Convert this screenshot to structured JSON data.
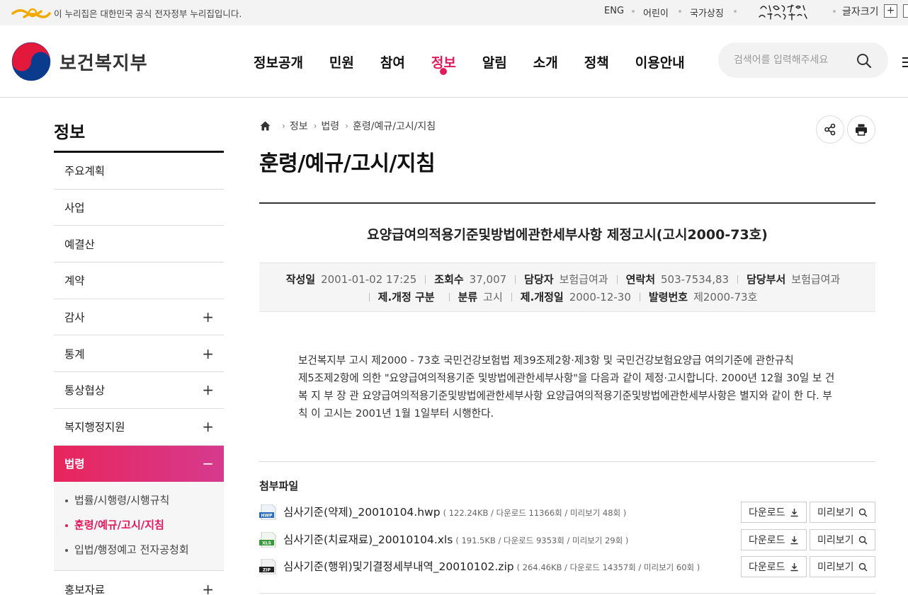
{
  "govbar": {
    "text": "이 누리집은 대한민국 공식 전자정부 누리집입니다.",
    "eng": "ENG",
    "kids": "어린이",
    "symbols": "국가상징",
    "font_size": "글자크기",
    "font_plus": "+",
    "font_minus": "-"
  },
  "header": {
    "brand": "보건복지부",
    "nav": [
      "정보공개",
      "민원",
      "참여",
      "정보",
      "알림",
      "소개",
      "정책",
      "이용안내"
    ],
    "search_placeholder": "검색어를 입력해주세요"
  },
  "lnb": {
    "title": "정보",
    "items": [
      {
        "label": "주요계획",
        "toggle": ""
      },
      {
        "label": "사업",
        "toggle": ""
      },
      {
        "label": "예결산",
        "toggle": ""
      },
      {
        "label": "계약",
        "toggle": ""
      },
      {
        "label": "감사",
        "toggle": "+"
      },
      {
        "label": "통계",
        "toggle": "+"
      },
      {
        "label": "통상협상",
        "toggle": "+"
      },
      {
        "label": "복지행정지원",
        "toggle": "+"
      },
      {
        "label": "법령",
        "toggle": "−"
      }
    ],
    "sub_items": [
      "법률/시행령/시행규칙",
      "훈령/예규/고시/지침",
      "입법/행정예고 전자공청회"
    ],
    "last_item": {
      "label": "홍보자료",
      "toggle": "+"
    }
  },
  "breadcrumb": [
    "정보",
    "법령",
    "훈령/예규/고시/지침"
  ],
  "page_title": "훈령/예규/고시/지침",
  "post": {
    "title": "요양급여의적용기준및방법에관한세부사항 제정고시(고시2000-73호)",
    "meta_row1": [
      {
        "k": "작성일",
        "v": "2001-01-02 17:25"
      },
      {
        "k": "조회수",
        "v": "37,007"
      },
      {
        "k": "담당자",
        "v": "보험급여과"
      },
      {
        "k": "연락처",
        "v": "503-7534,83"
      },
      {
        "k": "담당부서",
        "v": "보험급여과"
      }
    ],
    "meta_row2": [
      {
        "k": "제.개정 구분",
        "v": ""
      },
      {
        "k": "분류",
        "v": "고시"
      },
      {
        "k": "제.개정일",
        "v": "2000-12-30"
      },
      {
        "k": "발령번호",
        "v": "제2000-73호"
      }
    ],
    "body": [
      "보건복지부 고시 제2000 - 73호 국민건강보험법 제39조제2항·제3항 및 국민건강보험요양급 여의기준에 관한규칙",
      "제5조제2항에 의한 \"요양급여의적용기준 및방법에관한세부사항\"을 다음과 같이 제정·고시합니다. 2000년 12월 30일 보 건",
      "복 지 부 장 관 요양급여의적용기준및방법에관한세부사항 요양급여의적용기준및방법에관한세부사항은 별지와 같이 한 다. 부",
      "칙 이 고시는 2001년 1월 1일부터 시행한다."
    ]
  },
  "attachments": {
    "title": "첨부파일",
    "download_label": "다운로드",
    "preview_label": "미리보기",
    "files": [
      {
        "type": "HWP",
        "name": "심사기준(약제)_20010104.hwp",
        "info": "( 122.24KB / 다운로드 11366회 / 미리보기 48회 )"
      },
      {
        "type": "XLS",
        "name": "심사기준(치료재료)_20010104.xls",
        "info": "( 191.5KB / 다운로드 9353회 / 미리보기 29회 )"
      },
      {
        "type": "ZIP",
        "name": "심사기준(행위)및기결정세부내역_20010102.zip",
        "info": "( 264.46KB / 다운로드 14357회 / 미리보기 60회 )"
      }
    ]
  },
  "colors": {
    "accent": "#e3195c",
    "lnb_gradient_end": "#d63a8e",
    "gov_gold": "#f2a900"
  }
}
